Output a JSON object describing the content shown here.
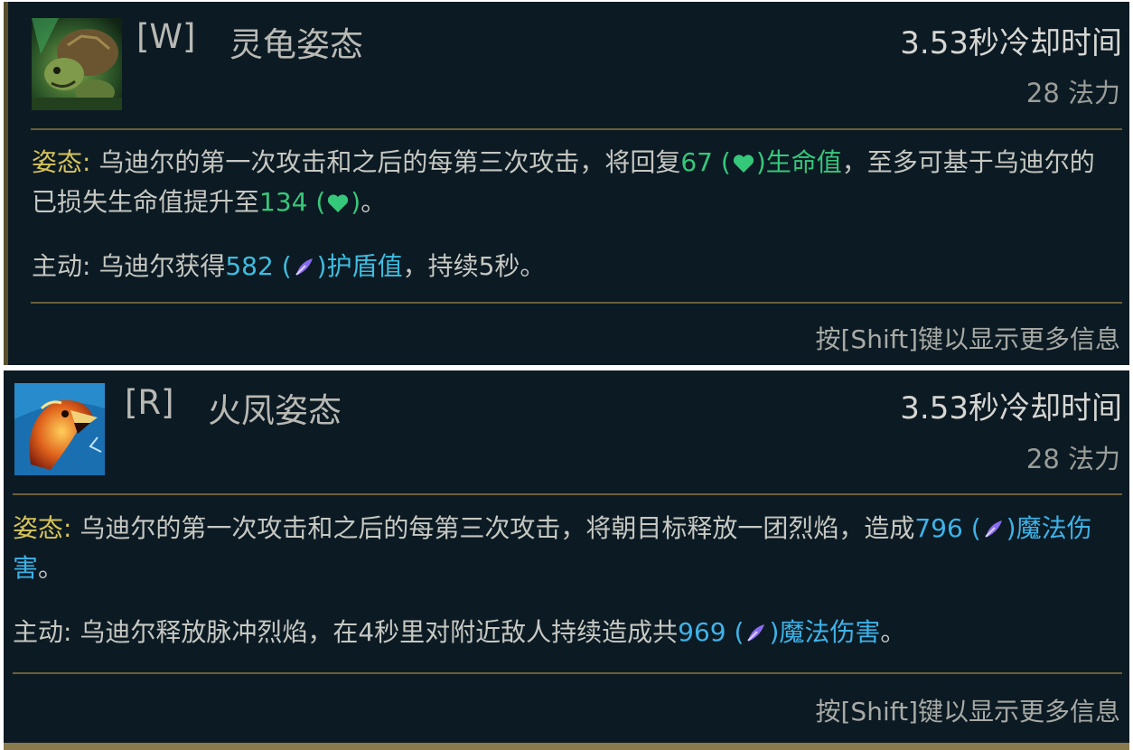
{
  "tooltips": [
    {
      "hotkey": "[W]",
      "name": "灵龟姿态",
      "icon": "turtle-stance-icon",
      "cooldown": "3.53秒冷却时间",
      "cost": "28 法力",
      "stance": {
        "label": "姿态:",
        "text1": " 乌迪尔的第一次攻击和之后的每第三次攻击，将回复",
        "value1": "67",
        "paren_open": " (",
        "icon1": "heart-icon",
        "paren_close": ")",
        "stat1": "生命值",
        "text2": "，至多可基于乌迪尔的已损失生命值提升至",
        "value2": "134",
        "paren_open2": " (",
        "icon2": "heart-icon",
        "paren_close2": ")",
        "text3": "。"
      },
      "active": {
        "label": "主动:",
        "text1": " 乌迪尔获得",
        "value": "582",
        "paren_open": " (",
        "icon": "ability-power-icon",
        "paren_close": ")",
        "stat": "护盾值",
        "text2": "，持续5秒。"
      },
      "hint": "按[Shift]键以显示更多信息"
    },
    {
      "hotkey": "[R]",
      "name": "火凤姿态",
      "icon": "phoenix-stance-icon",
      "cooldown": "3.53秒冷却时间",
      "cost": "28 法力",
      "stance": {
        "label": "姿态:",
        "text1": " 乌迪尔的第一次攻击和之后的每第三次攻击，将朝目标释放一团烈焰，造成",
        "value": "796",
        "paren_open": " (",
        "icon": "ability-power-icon",
        "paren_close": ")",
        "stat": "魔法伤害",
        "text2": "。"
      },
      "active": {
        "label": "主动:",
        "text1": " 乌迪尔释放脉冲烈焰，在4秒里对附近敌人持续造成共",
        "value": "969",
        "paren_open": " (",
        "icon": "ability-power-icon",
        "paren_close": ")",
        "stat": "魔法伤害",
        "text2": "。"
      },
      "hint": "按[Shift]键以显示更多信息"
    }
  ],
  "colors": {
    "panel_bg": "#0c1a23",
    "keyword": "#d6c35a",
    "heal": "#36c87a",
    "shield": "#3dbde0",
    "magic": "#3db3e8",
    "divider": "#7d6b3c"
  }
}
